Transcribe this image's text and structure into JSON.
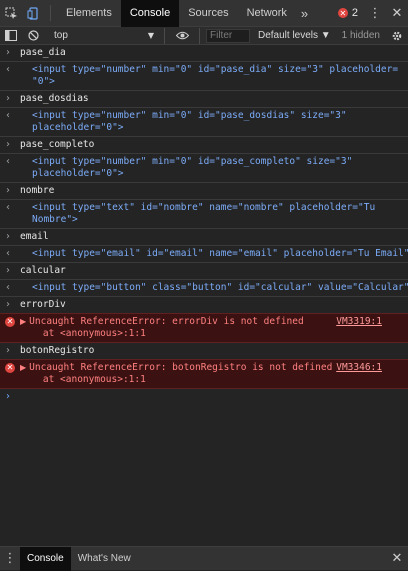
{
  "topbar": {
    "tabs": [
      "Elements",
      "Console",
      "Sources",
      "Network"
    ],
    "more": "»",
    "error_count": "2"
  },
  "toolbar": {
    "context": "top",
    "filter_placeholder": "Filter",
    "levels": "Default levels ▼",
    "hidden": "1 hidden"
  },
  "console": {
    "entries": [
      {
        "input": "pase_dia",
        "output": [
          "<input type=\"number\" min=\"0\" id=\"pase_dia\" size=\"3\" placeholder=",
          "\"0\">"
        ]
      },
      {
        "input": "pase_dosdias",
        "output": [
          "<input type=\"number\" min=\"0\" id=\"pase_dosdias\" size=\"3\"",
          "placeholder=\"0\">"
        ]
      },
      {
        "input": "pase_completo",
        "output": [
          "<input type=\"number\" min=\"0\" id=\"pase_completo\" size=\"3\"",
          "placeholder=\"0\">"
        ]
      },
      {
        "input": "nombre",
        "output": [
          "<input type=\"text\" id=\"nombre\" name=\"nombre\" placeholder=\"Tu",
          "Nombre\">"
        ]
      },
      {
        "input": "email",
        "output": [
          "<input type=\"email\" id=\"email\" name=\"email\" placeholder=\"Tu Email\">"
        ]
      },
      {
        "input": "calcular",
        "output": [
          "<input type=\"button\" class=\"button\" id=\"calcular\" value=\"Calcular\">"
        ]
      }
    ],
    "errors": [
      {
        "input": "errorDiv",
        "message": "Uncaught ReferenceError: errorDiv is not defined",
        "stack": "at <anonymous>:1:1",
        "source": "VM3319:1"
      },
      {
        "input": "botonRegistro",
        "message": "Uncaught ReferenceError: botonRegistro is not defined",
        "stack": "at <anonymous>:1:1",
        "source": "VM3346:1"
      }
    ]
  },
  "drawer": {
    "tabs": [
      "Console",
      "What's New"
    ]
  }
}
